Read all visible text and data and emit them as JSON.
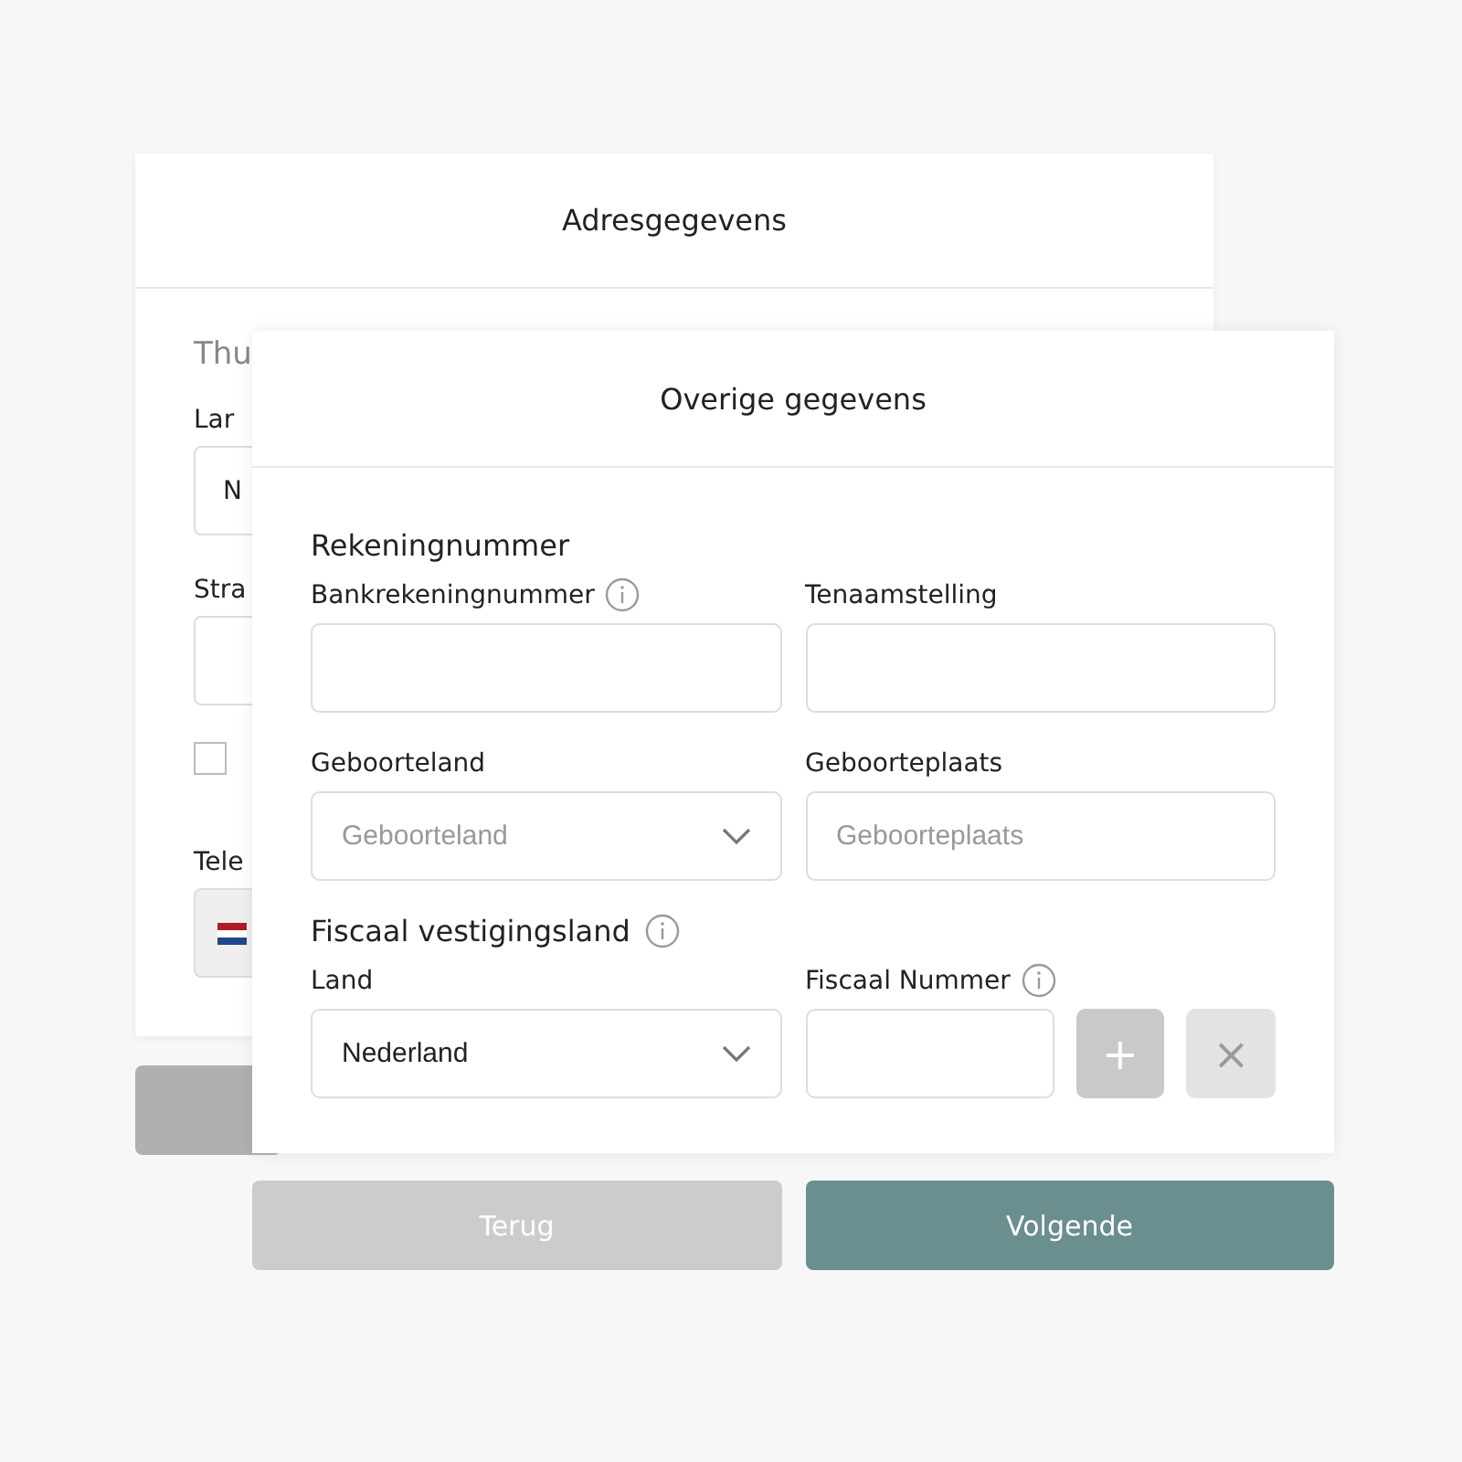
{
  "background_form": {
    "title": "Adresgegevens",
    "section_heading": "Thu",
    "fields": [
      {
        "kind": "text",
        "label": "Lar",
        "value": "N"
      },
      {
        "kind": "text",
        "label": "Stra"
      },
      {
        "kind": "checkbox",
        "checked": false
      },
      {
        "kind": "phone",
        "label": "Tele"
      }
    ]
  },
  "dialog": {
    "title": "Overige gegevens",
    "sections": [
      {
        "heading": "Rekeningnummer",
        "info": false,
        "rows": [
          [
            {
              "kind": "text",
              "label": "Bankrekeningnummer",
              "info": true
            },
            {
              "kind": "text",
              "label": "Tenaamstelling",
              "info": false
            }
          ],
          [
            {
              "kind": "select",
              "label": "Geboorteland",
              "info": false,
              "placeholder": "Geboorteland"
            },
            {
              "kind": "text",
              "label": "Geboorteplaats",
              "info": false,
              "placeholder": "Geboorteplaats"
            }
          ]
        ]
      },
      {
        "heading": "Fiscaal vestigingsland",
        "info": true,
        "rows": [
          [
            {
              "kind": "select",
              "label": "Land",
              "info": false,
              "value": "Nederland"
            },
            {
              "kind": "number_with_buttons",
              "label": "Fiscaal Nummer",
              "info": true,
              "add_button": {
                "label": "+",
                "disabled": false
              },
              "remove_button": {
                "label": "×",
                "disabled": true
              }
            }
          ]
        ]
      }
    ]
  },
  "footer_buttons": [
    {
      "kind": "secondary",
      "label": "Terug"
    },
    {
      "kind": "primary",
      "label": "Volgende"
    }
  ]
}
